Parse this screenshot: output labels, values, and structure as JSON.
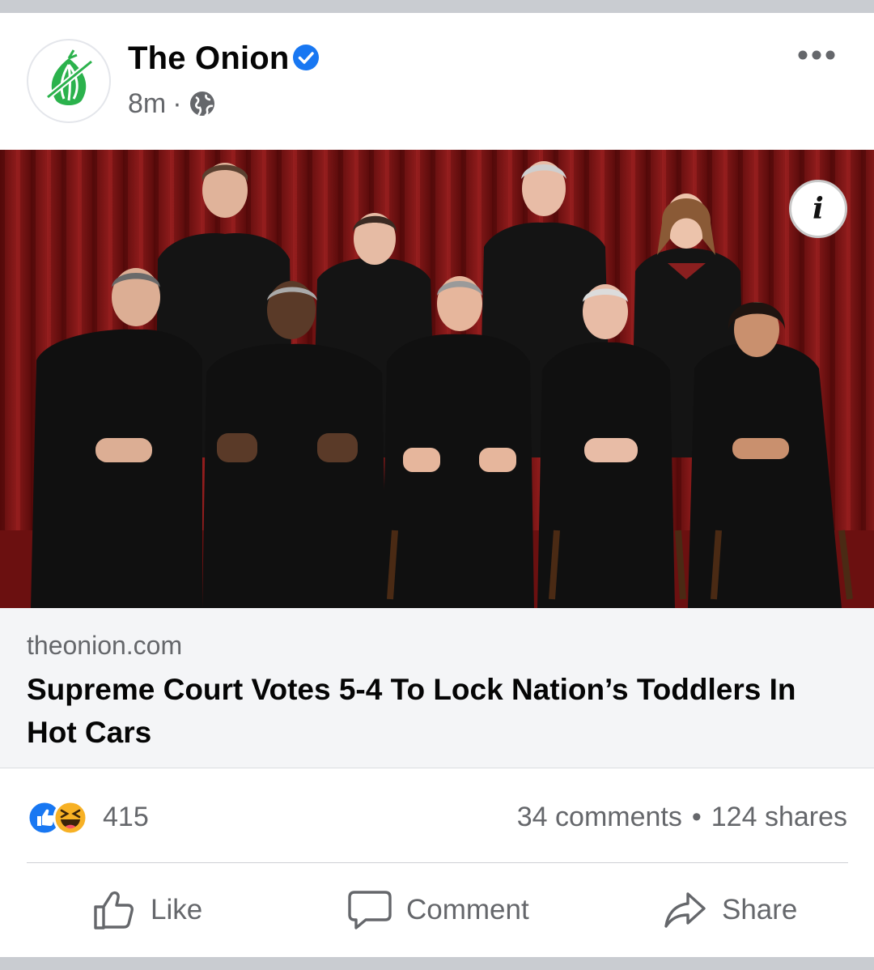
{
  "post": {
    "page_name": "The Onion",
    "verified_icon": "verified-badge-icon",
    "time": "8m",
    "separator": "·",
    "audience_icon": "globe-icon",
    "more_icon": "more-horizontal-icon"
  },
  "photo": {
    "info_label": "i"
  },
  "link": {
    "domain": "theonion.com",
    "headline": "Supreme Court Votes 5-4 To Lock Nation’s Toddlers In Hot Cars"
  },
  "stats": {
    "reaction_icons": [
      "like-reaction-icon",
      "haha-reaction-icon"
    ],
    "reaction_count": "415",
    "comments": "34 comments",
    "bullet": "•",
    "shares": "124 shares"
  },
  "actions": {
    "like_label": "Like",
    "comment_label": "Comment",
    "share_label": "Share"
  },
  "colors": {
    "brand_blue": "#1877f2",
    "onion_green": "#2bb24c",
    "secondary_text": "#65676b",
    "curtain_red": "#7a1414"
  }
}
